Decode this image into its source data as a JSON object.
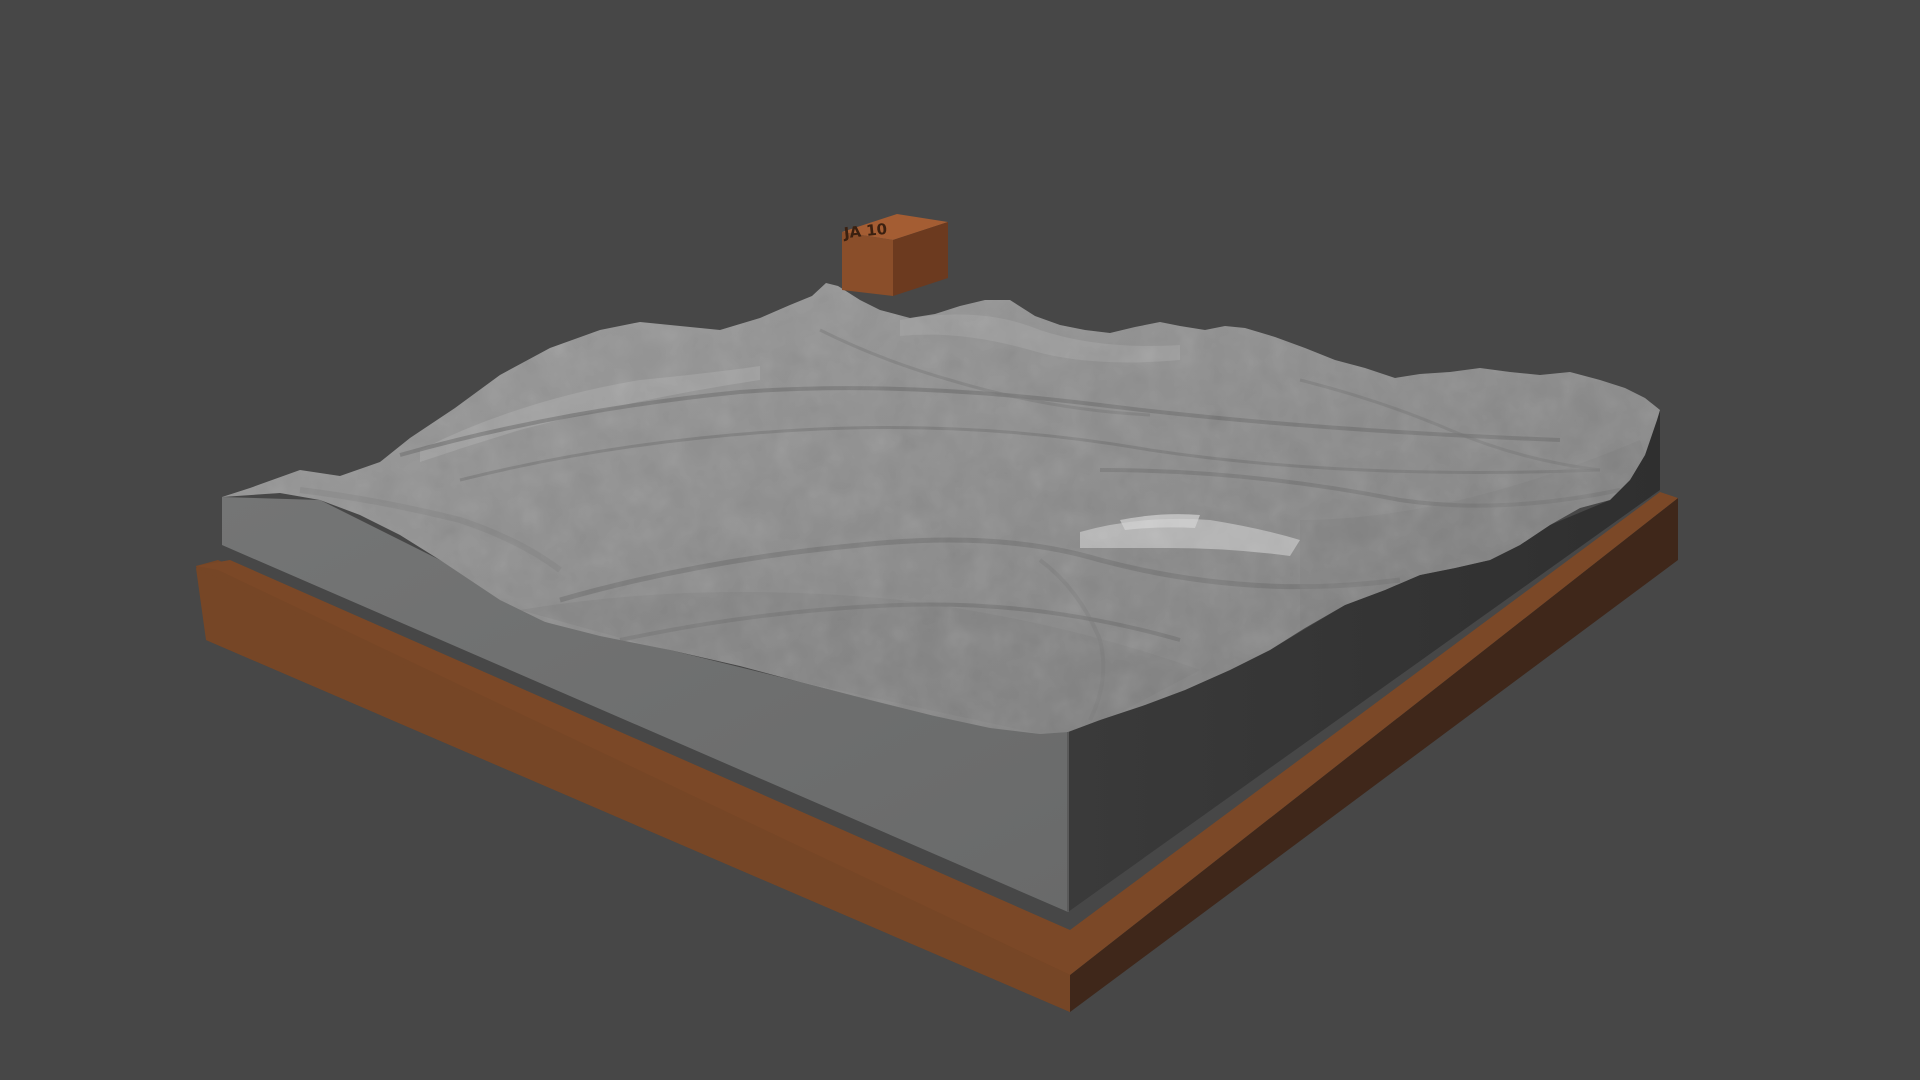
{
  "scene": {
    "description_visible_text": "",
    "background_color": "#474747",
    "model": {
      "terrain_top_color": "#8f8f8f",
      "terrain_highlight_color": "#b4b4b4",
      "terrain_side_light_color": "#6f7070",
      "terrain_side_dark_color": "#353535",
      "base_front_color": "#764626",
      "base_top_color": "#7a4828",
      "base_right_color": "#3f271a"
    },
    "marker": {
      "label": "JA 10",
      "front_color": "#8a4e2a",
      "top_color": "#a45d33",
      "side_color": "#6c3a1f"
    }
  }
}
